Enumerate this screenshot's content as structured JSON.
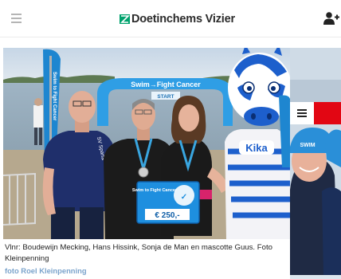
{
  "header": {
    "brand": "Doetinchems Vizier",
    "menu_icon": "hamburger-menu-icon",
    "user_icon": "add-user-icon",
    "brand_color": "#00a26d"
  },
  "article_image": {
    "arch_title": "Swim→Fight Cancer",
    "arch_subtitle": "START",
    "flag_text": "Swim to Fight Cancer",
    "shirt_text": "SV Sparta",
    "cheque_title": "Swim to Fight Cancer",
    "cheque_amount": "€ 250,-",
    "mascot_shirt_text": "Kika",
    "badge_text": "SWIM"
  },
  "caption": {
    "text": "Vlnr: Boudewijn Mecking, Hans Hissink, Sonja de Man en mascotte Guus. Foto Kleinpenning",
    "credit": "foto Roel Kleinpenning"
  },
  "next_slide": {
    "menu_icon": "hamburger-menu-icon",
    "accent_color": "#e20613"
  }
}
